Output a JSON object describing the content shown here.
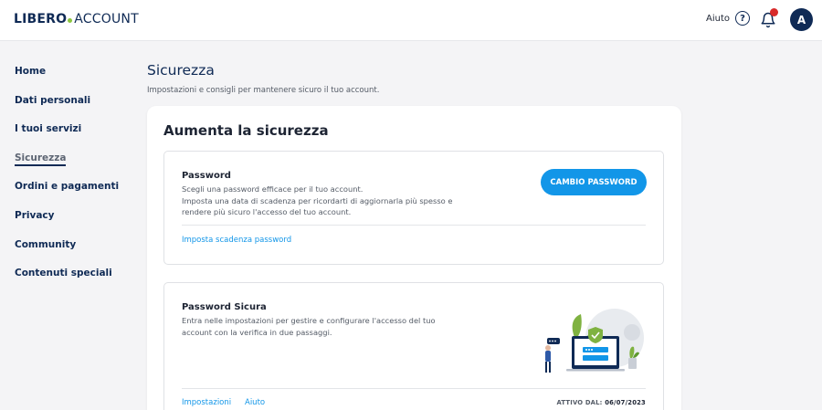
{
  "header": {
    "logo_brand": "LIBERO",
    "logo_product": "ACCOUNT",
    "help_label": "Aiuto",
    "help_icon": "question-icon",
    "bell_icon": "bell-icon",
    "avatar_initial": "A",
    "notification_badge_color": "#d82a2a"
  },
  "sidebar": {
    "items": [
      {
        "label": "Home"
      },
      {
        "label": "Dati personali"
      },
      {
        "label": "I tuoi servizi"
      },
      {
        "label": "Sicurezza",
        "active": true
      },
      {
        "label": "Ordini e pagamenti"
      },
      {
        "label": "Privacy"
      },
      {
        "label": "Community"
      },
      {
        "label": "Contenuti speciali"
      }
    ]
  },
  "main": {
    "title": "Sicurezza",
    "subtitle": "Impostazioni e consigli per mantenere sicuro il tuo account.",
    "card_title": "Aumenta la sicurezza",
    "password_box": {
      "title": "Password",
      "desc_line1": "Scegli una password efficace per il tuo account.",
      "desc_line2": "Imposta una data di scadenza per ricordarti di aggiornarla più spesso e",
      "desc_line3": "rendere più sicuro l'accesso del tuo account.",
      "button_label": "CAMBIO PASSWORD",
      "link_label": "Imposta scadenza password"
    },
    "secure_box": {
      "title": "Password Sicura",
      "desc_line1": "Entra nelle impostazioni per gestire e configurare l'accesso del tuo",
      "desc_line2": "account con la verifica in due passaggi.",
      "settings_link": "Impostazioni",
      "help_link": "Aiuto",
      "active_label": "ATTIVO DAL:",
      "active_date": "06/07/2023",
      "illustration_icon": "security-illustration-icon"
    }
  },
  "colors": {
    "accent": "#1296e8",
    "navy": "#0f2a55",
    "logo_dot": "#8cc63f"
  }
}
